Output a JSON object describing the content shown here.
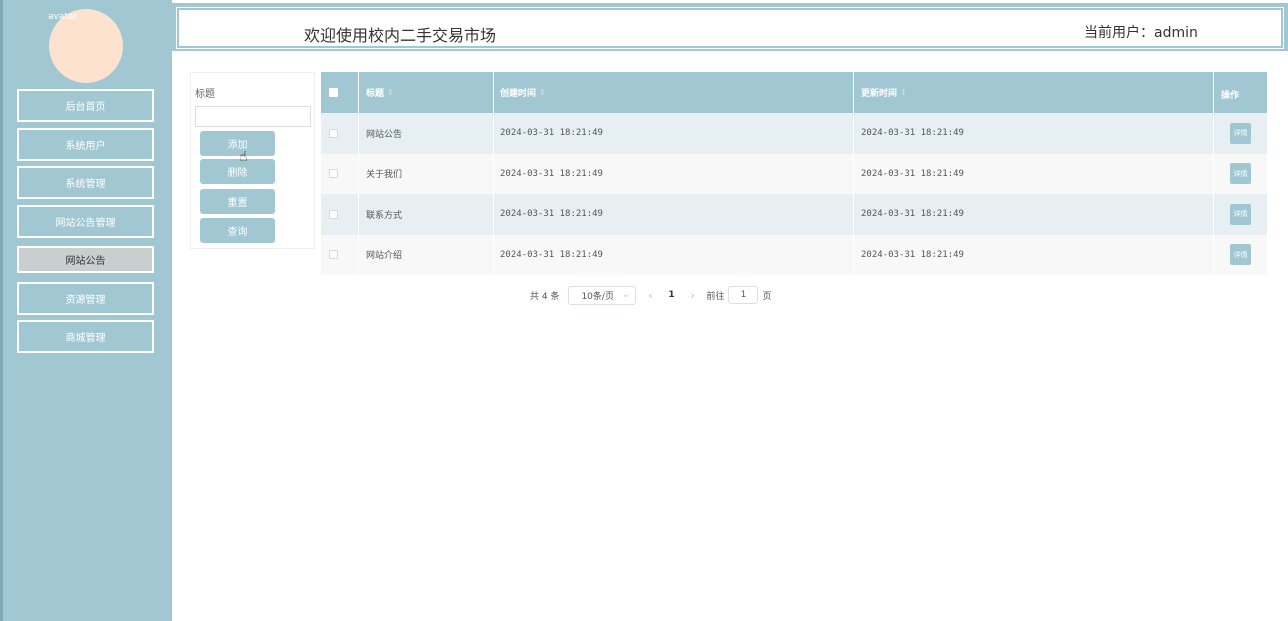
{
  "header": {
    "title": "欢迎使用校内二手交易市场",
    "current_user": "当前用户：admin"
  },
  "sidebar": {
    "avatar_alt": "avatar",
    "items": [
      {
        "label": "后台首页"
      },
      {
        "label": "系统用户"
      },
      {
        "label": "系统管理"
      },
      {
        "label": "网站公告管理"
      },
      {
        "label": "网站公告"
      },
      {
        "label": "资源管理"
      },
      {
        "label": "商城管理"
      }
    ],
    "active_index": 4
  },
  "search": {
    "label": "标题",
    "input_value": "",
    "buttons": {
      "add": "添加",
      "delete": "删除",
      "reset": "重置",
      "query": "查询"
    }
  },
  "table": {
    "columns": {
      "title": "标题",
      "created": "创建时间",
      "updated": "更新时间",
      "actions": "操作"
    },
    "rows": [
      {
        "title": "网站公告",
        "created": "2024-03-31 18:21:49",
        "updated": "2024-03-31 18:21:49",
        "action": "详情"
      },
      {
        "title": "关于我们",
        "created": "2024-03-31 18:21:49",
        "updated": "2024-03-31 18:21:49",
        "action": "详情"
      },
      {
        "title": "联系方式",
        "created": "2024-03-31 18:21:49",
        "updated": "2024-03-31 18:21:49",
        "action": "详情"
      },
      {
        "title": "网站介绍",
        "created": "2024-03-31 18:21:49",
        "updated": "2024-03-31 18:21:49",
        "action": "详情"
      }
    ]
  },
  "pagination": {
    "total": "共 4 条",
    "page_size": "10条/页",
    "current_page": "1",
    "goto_label": "前往",
    "goto_value": "1",
    "page_suffix": "页"
  },
  "colors": {
    "accent": "#a1c8d2",
    "row_alt": "#e7eff2"
  }
}
